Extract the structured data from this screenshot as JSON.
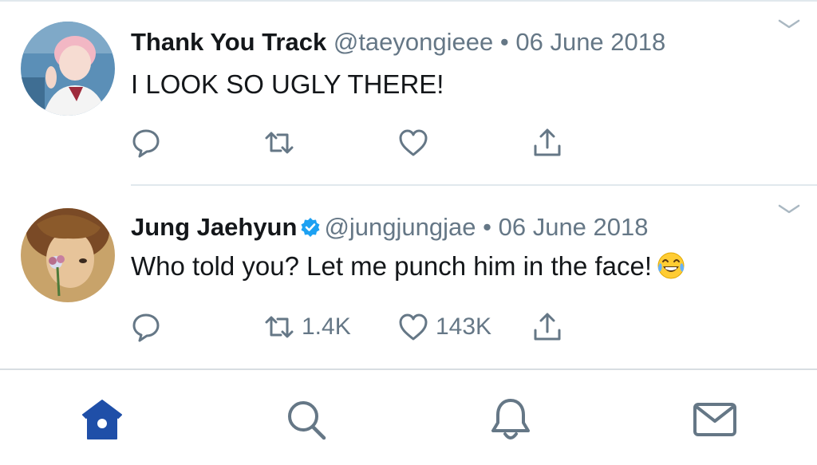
{
  "tweets": [
    {
      "name": "Thank You Track",
      "handle": "@taeyongieee",
      "separator": "•",
      "date": "06 June 2018",
      "text": "I LOOK SO UGLY THERE!",
      "verified": false,
      "retweets": "",
      "likes": ""
    },
    {
      "name": "Jung Jaehyun",
      "handle": "@jungjungjae",
      "separator": "•",
      "date": "06 June 2018",
      "text": "Who told you? Let me punch him in the face!",
      "verified": true,
      "retweets": "1.4K",
      "likes": "143K"
    }
  ],
  "icons": {
    "reply": "reply-icon",
    "retweet": "retweet-icon",
    "like": "heart-icon",
    "share": "share-icon",
    "more": "chevron-down-icon",
    "verified": "verified-badge-icon",
    "emoji": "tears-of-joy-emoji"
  },
  "tabbar": {
    "items": [
      "home-icon",
      "search-icon",
      "notifications-icon",
      "messages-icon"
    ],
    "active": "home-icon"
  },
  "colors": {
    "text": "#14171a",
    "secondary": "#657786",
    "accent": "#1da1f2",
    "active_tab": "#1f4fa8"
  }
}
